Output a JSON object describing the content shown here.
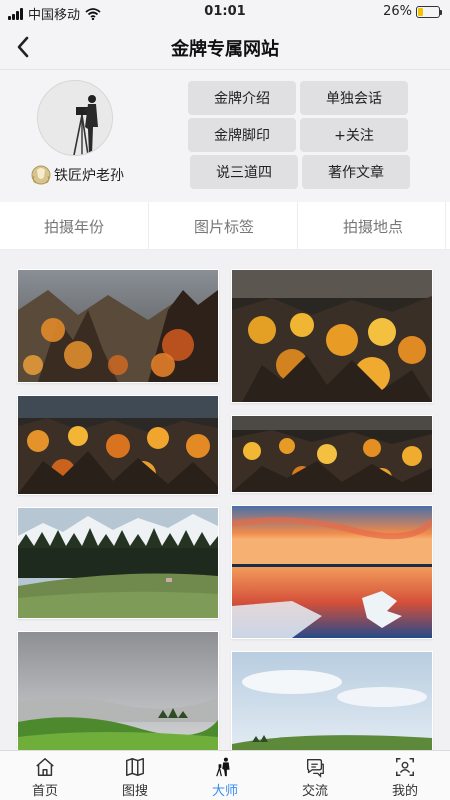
{
  "status": {
    "carrier": "中国移动",
    "time": "01:01",
    "battery_text": "26%",
    "battery_level": 0.26
  },
  "header": {
    "title": "金牌专属网站"
  },
  "profile": {
    "username": "铁匠炉老孙",
    "actions": [
      "金牌介绍",
      "单独会话",
      "金牌脚印",
      "+关注",
      "说三道四",
      "著作文章"
    ]
  },
  "filters": [
    "拍摄年份",
    "图片标签",
    "拍摄地点"
  ],
  "gallery": {
    "photos": [
      {
        "scene": "autumn-rocks-sunset"
      },
      {
        "scene": "autumn-hillside-golden"
      },
      {
        "scene": "autumn-rocks-wide"
      },
      {
        "scene": "autumn-rocks-narrow"
      },
      {
        "scene": "mountain-forest-meadow"
      },
      {
        "scene": "salt-lake-sunset"
      },
      {
        "scene": "misty-hills-green"
      },
      {
        "scene": "sky-green-hill"
      }
    ]
  },
  "tabbar": {
    "items": [
      {
        "label": "首页",
        "icon": "home-icon"
      },
      {
        "label": "图搜",
        "icon": "map-icon"
      },
      {
        "label": "大师",
        "icon": "photographer-icon"
      },
      {
        "label": "交流",
        "icon": "chat-icon"
      },
      {
        "label": "我的",
        "icon": "profile-icon"
      }
    ],
    "active_index": 2,
    "active_color": "#3a8df0"
  }
}
